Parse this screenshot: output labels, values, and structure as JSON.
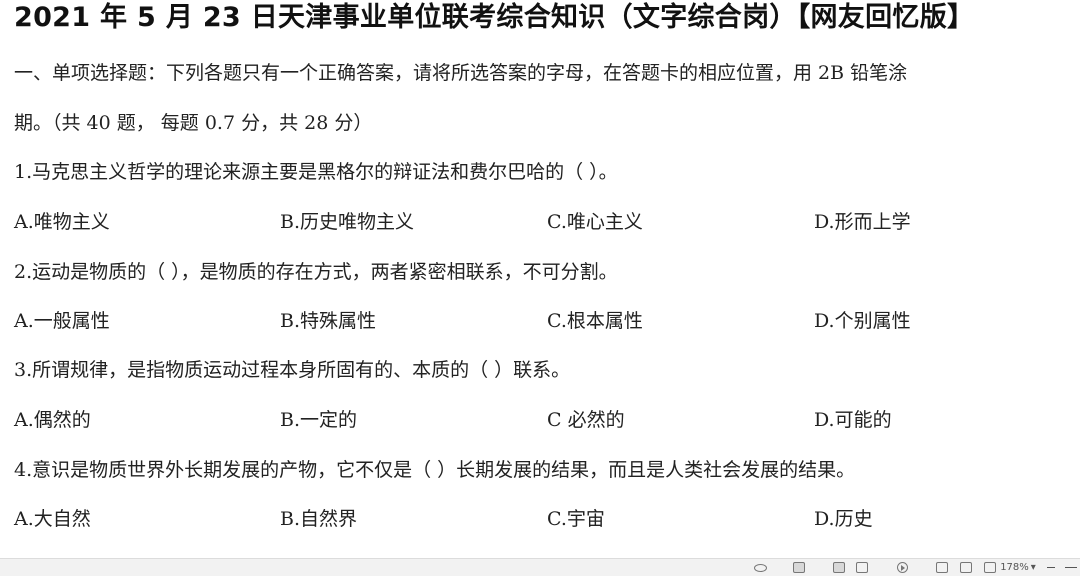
{
  "document": {
    "title": "2021 年 5 月 23 日天津事业单位联考综合知识（文字综合岗）【网友回忆版】",
    "instructions_line1": "一、单项选择题：下列各题只有一个正确答案，请将所选答案的字母，在答题卡的相应位置，用 2B 铅笔涂",
    "instructions_line2": "期。（共 40 题， 每题 0.7 分，共 28 分）",
    "questions": [
      {
        "text": "1.马克思主义哲学的理论来源主要是黑格尔的辩证法和费尔巴哈的（    ）。",
        "options": [
          "A.唯物主义",
          "B.历史唯物主义",
          "C.唯心主义",
          "D.形而上学"
        ]
      },
      {
        "text": "2.运动是物质的（ ），是物质的存在方式，两者紧密相联系，不可分割。",
        "options": [
          "A.一般属性",
          "B.特殊属性",
          "C.根本属性",
          "D.个别属性"
        ]
      },
      {
        "text": "3.所谓规律，是指物质运动过程本身所固有的、本质的（    ）联系。",
        "options": [
          "A.偶然的",
          "B.一定的",
          "C 必然的",
          "D.可能的"
        ]
      },
      {
        "text": "4.意识是物质世界外长期发展的产物，它不仅是（ ）长期发展的结果，而且是人类社会发展的结果。",
        "options": [
          "A.大自然",
          "B.自然界",
          "C.宇宙",
          "D.历史"
        ]
      }
    ]
  },
  "statusbar": {
    "zoom": "178%",
    "icons": [
      "eye-icon",
      "page-view-icon",
      "reading-view-icon",
      "play-icon",
      "web-layout-icon",
      "outline-icon",
      "page-layout-icon",
      "zoom-out-icon"
    ]
  }
}
